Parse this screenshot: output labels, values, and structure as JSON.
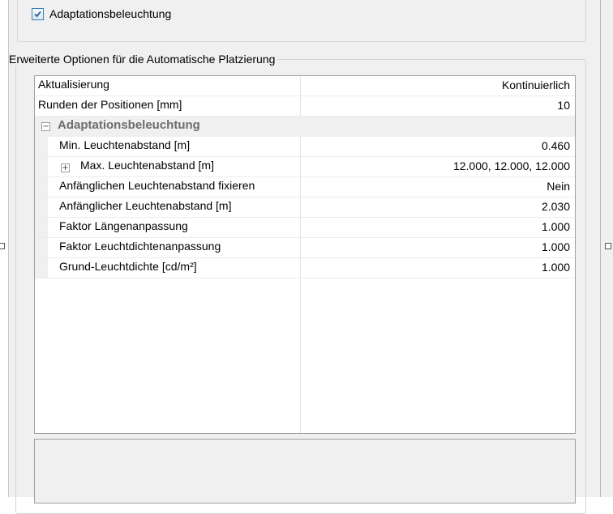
{
  "checkbox": {
    "label": "Adaptationsbeleuchtung",
    "checked": true
  },
  "options_group": {
    "title": "Erweiterte Optionen für die Automatische Platzierung"
  },
  "properties": [
    {
      "name": "Aktualisierung",
      "value": "Kontinuierlich"
    },
    {
      "name": "Runden der Positionen [mm]",
      "value": "10"
    },
    {
      "category": "Adaptationsbeleuchtung",
      "expander": "⊟"
    },
    {
      "name": "Min. Leuchtenabstand [m]",
      "value": "0.460"
    },
    {
      "name": "Max. Leuchtenabstand [m]",
      "value": "12.000, 12.000, 12.000",
      "expander": "⊞"
    },
    {
      "name": "Anfänglichen Leuchtenabstand fixieren",
      "value": "Nein"
    },
    {
      "name": "Anfänglicher Leuchtenabstand [m]",
      "value": "2.030"
    },
    {
      "name": "Faktor Längenanpassung",
      "value": "1.000"
    },
    {
      "name": "Faktor Leuchtdichtenanpassung",
      "value": "1.000"
    },
    {
      "name": "Grund-Leuchtdichte [cd/m²]",
      "value": "1.000"
    }
  ],
  "icons": {
    "checkmark": "checkmark-icon",
    "collapse": "minus-box-icon",
    "expand": "plus-box-icon"
  },
  "colors": {
    "category_text": "#6d6d6d",
    "checkbox_border": "#3c7fb1",
    "panel_bg": "#f0f0f0"
  }
}
